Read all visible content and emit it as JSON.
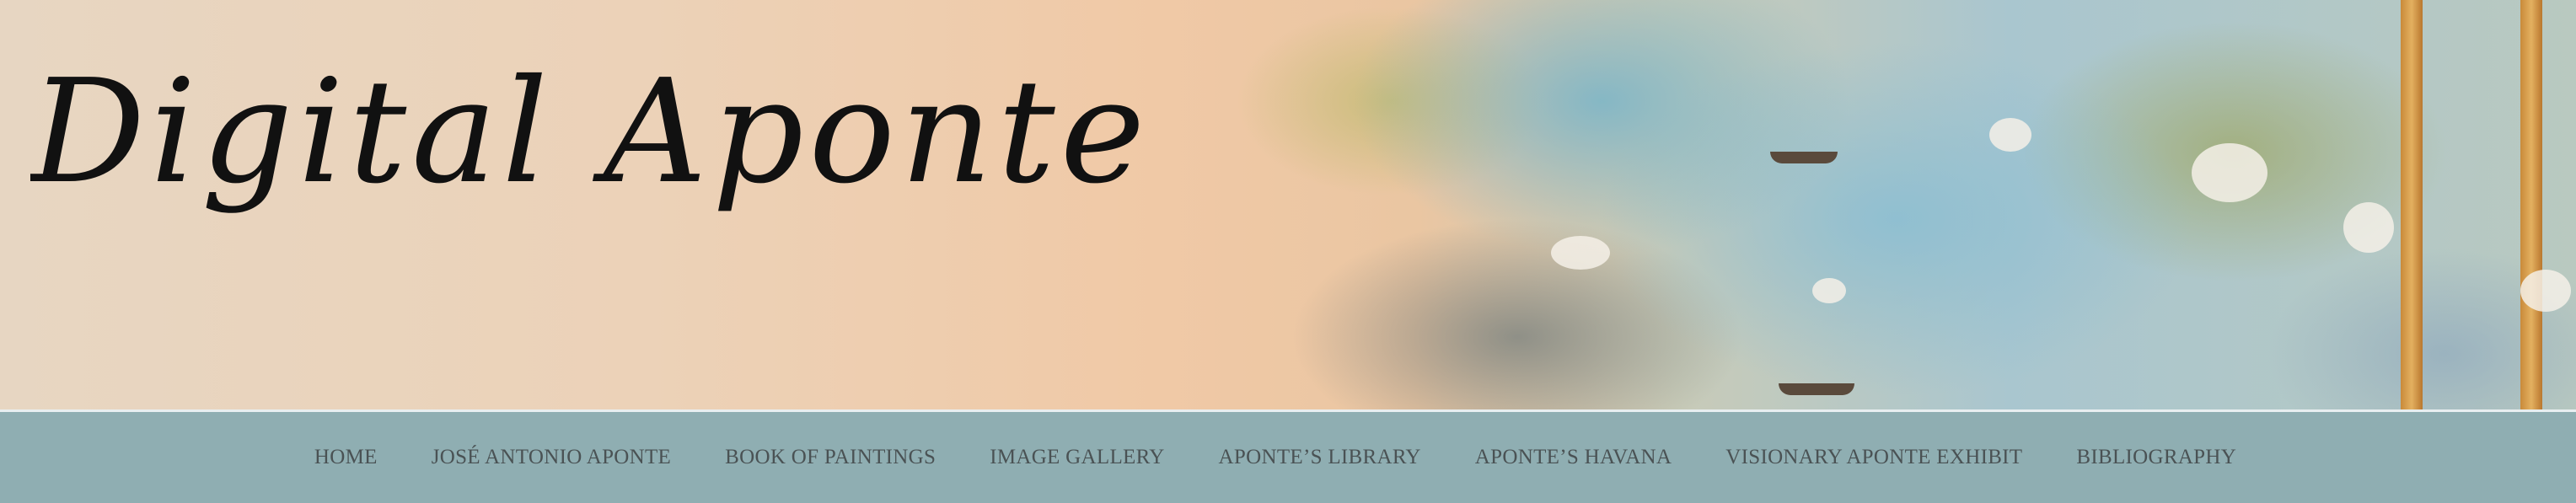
{
  "site": {
    "logo_text": "Digital Aponte"
  },
  "nav": {
    "items": [
      {
        "label": "HOME"
      },
      {
        "label": "JOSÉ ANTONIO APONTE"
      },
      {
        "label": "BOOK OF PAINTINGS"
      },
      {
        "label": "IMAGE GALLERY"
      },
      {
        "label": "APONTE’S LIBRARY"
      },
      {
        "label": "APONTE’S HAVANA"
      },
      {
        "label": "VISIONARY APONTE EXHIBIT"
      },
      {
        "label": "BIBLIOGRAPHY"
      }
    ]
  },
  "colors": {
    "nav_background": "#8faeb2",
    "nav_text": "#4a5254",
    "logo_ink": "#111111"
  }
}
